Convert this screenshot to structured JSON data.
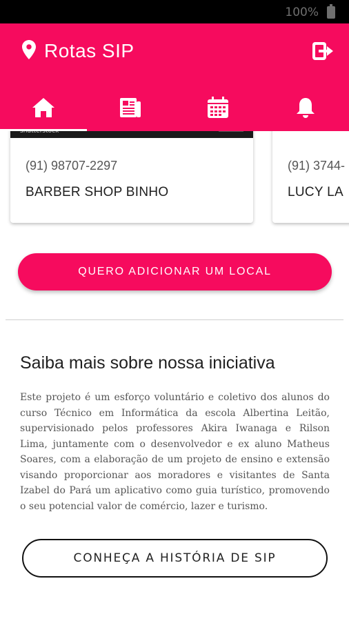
{
  "status_bar": {
    "battery_text": "100%"
  },
  "app_bar": {
    "title": "Rotas SIP",
    "pin_icon": "location-pin-icon",
    "logout_icon": "logout-icon",
    "tabs": [
      {
        "icon": "home-icon",
        "selected": true
      },
      {
        "icon": "newspaper-icon",
        "selected": false
      },
      {
        "icon": "calendar-icon",
        "selected": false
      },
      {
        "icon": "bell-icon",
        "selected": false
      }
    ]
  },
  "places": [
    {
      "phone": "(91) 98707-2297",
      "name": "BARBER SHOP BINHO",
      "image_watermark": "shutterstock"
    },
    {
      "phone": "(91) 3744-",
      "name": "LUCY LA"
    }
  ],
  "add_location_label": "QUERO ADICIONAR UM LOCAL",
  "about": {
    "title": "Saiba mais sobre nossa iniciativa",
    "text": "Este projeto é um esforço voluntário e coletivo dos alunos do curso Técnico em Informática da escola Albertina Leitão, supervisionado pelos professores Akira Iwanaga e Rilson Lima, juntamente com o desenvolvedor e ex aluno Matheus Soares, com a elaboração de um projeto de ensino e extensão visando proporcionar aos moradores e visitantes de Santa Izabel do Pará um aplicativo como guia turístico, promovendo o seu potencial valor de comércio, lazer e turismo.",
    "history_button_label": "CONHEÇA A HISTÓRIA DE SIP"
  },
  "colors": {
    "primary": "#f60b5e",
    "text_dark": "#1f1f1f",
    "text_muted": "#555555"
  }
}
